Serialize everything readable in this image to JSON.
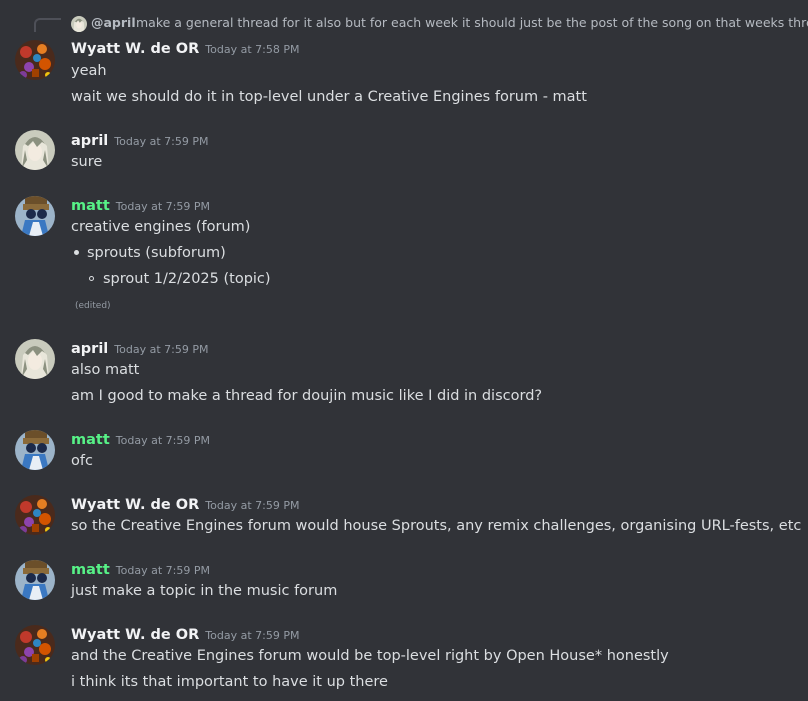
{
  "reply": {
    "mention": "@april",
    "text": "make a general thread for it also but for each week it should just be the post of the song on that weeks thread"
  },
  "messages": [
    {
      "author": "Wyatt W. de OR",
      "timestamp": "Today at 7:58 PM",
      "lines": [
        "yeah",
        "wait we should do it in top-level under a Creative Engines forum - matt"
      ]
    },
    {
      "author": "april",
      "timestamp": "Today at 7:59 PM",
      "lines": [
        "sure"
      ]
    },
    {
      "author": "matt",
      "timestamp": "Today at 7:59 PM",
      "lines": [
        "creative engines (forum)"
      ],
      "list": [
        "sprouts (subforum)",
        "sprout 1/2/2025 (topic)"
      ],
      "edited": "(edited)"
    },
    {
      "author": "april",
      "timestamp": "Today at 7:59 PM",
      "lines": [
        "also matt",
        "am I good to make a thread for doujin music like I did in discord?"
      ]
    },
    {
      "author": "matt",
      "timestamp": "Today at 7:59 PM",
      "lines": [
        "ofc"
      ]
    },
    {
      "author": "Wyatt W. de OR",
      "timestamp": "Today at 7:59 PM",
      "lines": [
        "so the Creative Engines forum would house Sprouts, any remix challenges, organising URL-fests, etc"
      ]
    },
    {
      "author": "matt",
      "timestamp": "Today at 7:59 PM",
      "lines": [
        "just make a topic in the music forum"
      ]
    },
    {
      "author": "Wyatt W. de OR",
      "timestamp": "Today at 7:59 PM",
      "lines": [
        "and the Creative Engines forum would be top-level right by Open House* honestly",
        "i think its that important to have it up there"
      ]
    }
  ],
  "colors": {
    "background": "#313338",
    "text": "#dbdee1",
    "muted": "#949ba4",
    "author_default": "#f2f3f5",
    "author_matt": "#57f287"
  }
}
